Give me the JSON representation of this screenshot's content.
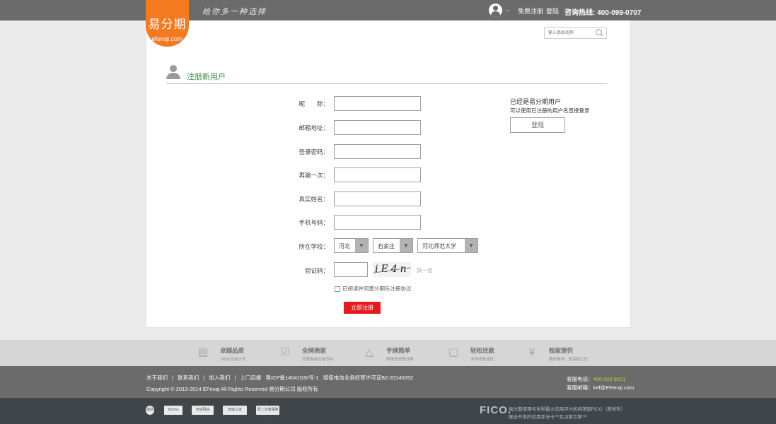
{
  "header": {
    "slogan": "给你多一种选择",
    "user_links": [
      "免费注册",
      "登陆"
    ],
    "hotline": "咨询热线: 400-099-0707"
  },
  "logo": {
    "cn": "易分期",
    "en": "efenqi.com"
  },
  "search": {
    "placeholder": "输入商品名称"
  },
  "section": {
    "title": "注册新用户"
  },
  "form": {
    "nickname_label": "昵　　称：",
    "email_label": "邮箱地址：",
    "password_label": "登录密码：",
    "confirm_label": "再输一次：",
    "realname_label": "真实姓名：",
    "phone_label": "手机号码：",
    "school_label": "所在学校：",
    "province": "河北",
    "city": "石家庄",
    "school": "河北师范大学",
    "captcha_label": "验证码：",
    "captcha_text": "iE4n",
    "refresh_label": "换一张",
    "agree_text": "已阅读并同意分期乐注册协议",
    "submit_label": "立即注册"
  },
  "sidebar": {
    "title": "已经是易分期用户",
    "desc": "可以使用已注册的用户名直接登录",
    "login_label": "登陆"
  },
  "features": [
    {
      "title": "卓越品质",
      "sub": "100%正品行货",
      "icon": "quality-icon"
    },
    {
      "title": "全网商家",
      "sub": "优惠商品应有尽有",
      "icon": "merchant-icon"
    },
    {
      "title": "手续简单",
      "sub": "简单全流程分期",
      "icon": "graduation-cap-icon"
    },
    {
      "title": "轻松还款",
      "sub": "多种还款途径",
      "icon": "repay-icon"
    },
    {
      "title": "独家提供",
      "sub": "随时随地，无后顾之忧",
      "icon": "yen-icon"
    }
  ],
  "footer": {
    "links": [
      "关于我们",
      "|",
      "联系我们",
      "|",
      "加入我们",
      "|",
      "上门自提",
      "粤ICP备14041530号-1",
      "增值电信业务经营许可证B2-20140262"
    ],
    "copyright": "Copyright © 2013-2014 EFenqi All Rights Reserved 易分期公司 版权所有",
    "tel_label": "客服电话：",
    "tel_value": "400 005 9151",
    "mail": "客服邮箱：kef@EFenqi.com"
  },
  "bottom": {
    "badges": [
      "诚信",
      "Norton",
      "可信网站",
      "权威认证",
      "网上交易保障中心"
    ],
    "fico": "FICO.",
    "fico_text1": "易分期使用与世界最大信用评分机构美国FICO（费埃哲）",
    "fico_text2": "联合开发的信用评分卡™及决策引擎™"
  },
  "colors": {
    "accent_orange": "#f47a20",
    "accent_green": "#3a8a3e",
    "submit_red": "#e51a1f"
  }
}
